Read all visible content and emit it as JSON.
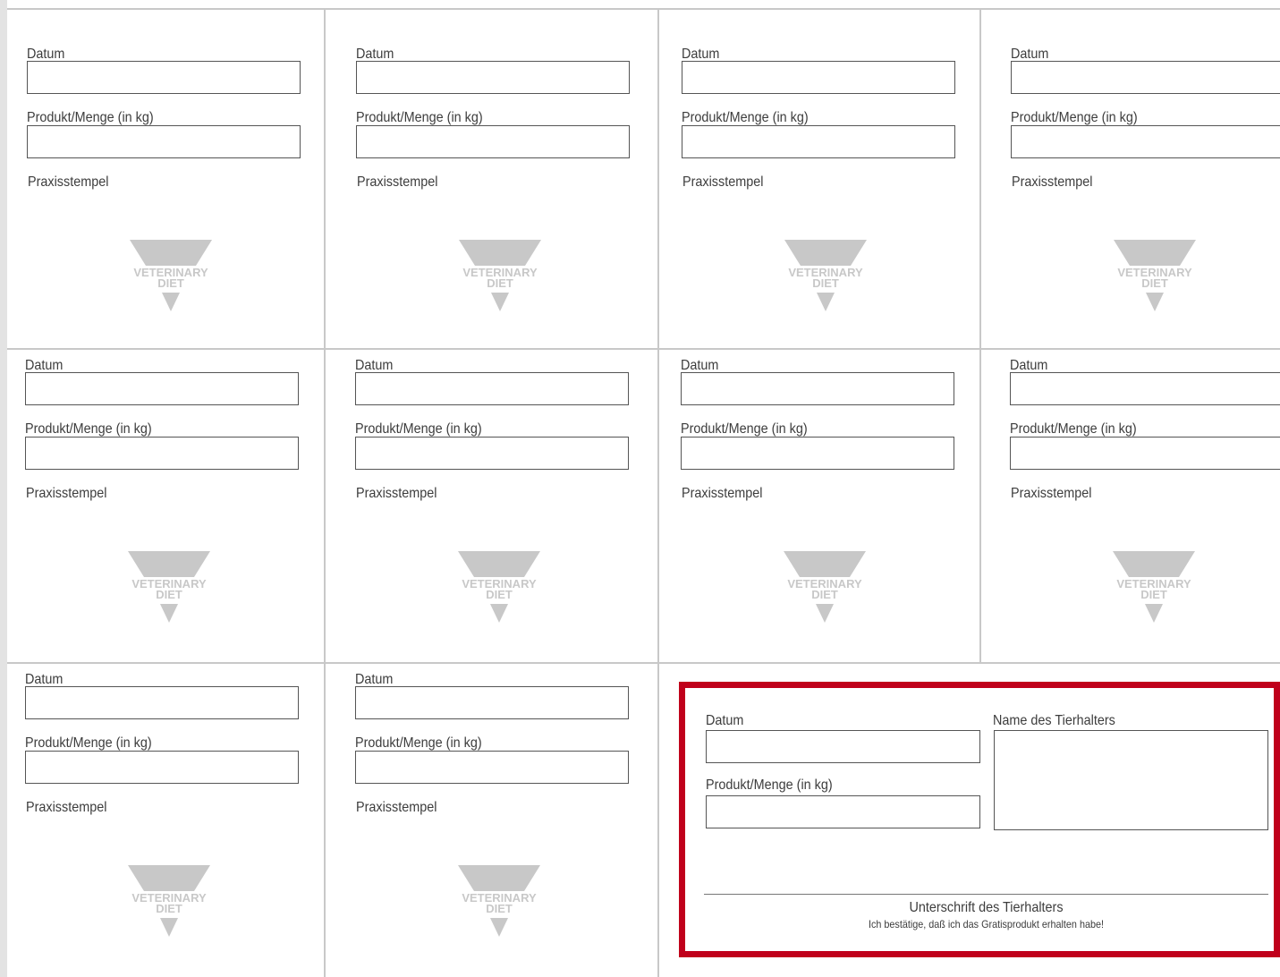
{
  "labels": {
    "date": "Datum",
    "product_qty": "Produkt/Menge (in kg)",
    "stamp": "Praxisstempel"
  },
  "logo": {
    "line1": "VETERINARY",
    "line2": "DIET",
    "color": "#c8c8c8"
  },
  "coupon": {
    "date_label": "Datum",
    "product_label": "Produkt/Menge (in kg)",
    "owner_name_label": "Name des Tierhalters",
    "signature_label": "Unterschrift des Tierhalters",
    "confirmation_text": "Ich bestätige, daß ich das Gratisprodukt erhalten habe!",
    "border_color": "#c0001b"
  },
  "fields": {
    "date_value": "",
    "product_value": "",
    "owner_name_value": ""
  }
}
